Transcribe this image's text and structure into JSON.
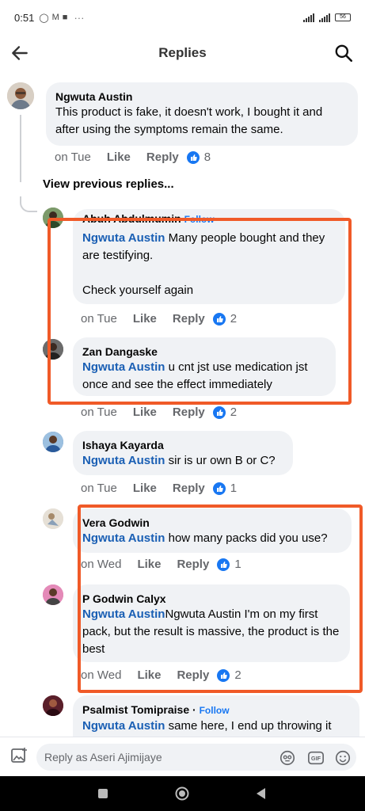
{
  "status": {
    "time": "0:51",
    "icons": [
      "whatsapp-icon",
      "gmail-icon",
      "app-icon"
    ],
    "dots": "···",
    "battery": "56"
  },
  "header": {
    "title": "Replies"
  },
  "view_previous": "View previous replies...",
  "comments": [
    {
      "author": "Ngwuta Austin",
      "text": "This product is fake, it doesn't work, I bought it and after using the symptoms remain the same.",
      "when": "on Tue",
      "like": "Like",
      "reply": "Reply",
      "count": "8"
    },
    {
      "author": "Abuh Abdulmumin",
      "follow": "Follow",
      "mention": "Ngwuta Austin",
      "text": " Many people bought and they are testifying.",
      "text2": "Check yourself again",
      "when": "on Tue",
      "like": "Like",
      "reply": "Reply",
      "count": "2"
    },
    {
      "author": "Zan Dangaske",
      "mention": "Ngwuta Austin",
      "text": " u cnt jst use medication jst once and see the effect immediately",
      "when": "on Tue",
      "like": "Like",
      "reply": "Reply",
      "count": "2"
    },
    {
      "author": "Ishaya Kayarda",
      "mention": "Ngwuta Austin",
      "text": " sir is ur own B or C?",
      "when": "on Tue",
      "like": "Like",
      "reply": "Reply",
      "count": "1"
    },
    {
      "author": "Vera Godwin",
      "mention": "Ngwuta Austin",
      "text": " how many packs did you use?",
      "when": "on Wed",
      "like": "Like",
      "reply": "Reply",
      "count": "1"
    },
    {
      "author": "P Godwin Calyx",
      "mention": "Ngwuta Austin",
      "text": "Ngwuta Austin I'm on my first pack, but the result is massive, the product is the best",
      "when": "on Wed",
      "like": "Like",
      "reply": "Reply",
      "count": "2"
    },
    {
      "author": "Psalmist Tomipraise",
      "separator": " · ",
      "follow": "Follow",
      "mention": "Ngwuta Austin",
      "text": " same here, I end up throwing it"
    }
  ],
  "reply_input": {
    "placeholder": "Reply as Aseri Ajimijaye"
  },
  "colors": {
    "highlight": "#f05a28",
    "mention": "#1a5fb4",
    "like_blue": "#1877f2",
    "bubble": "#f0f2f5"
  }
}
